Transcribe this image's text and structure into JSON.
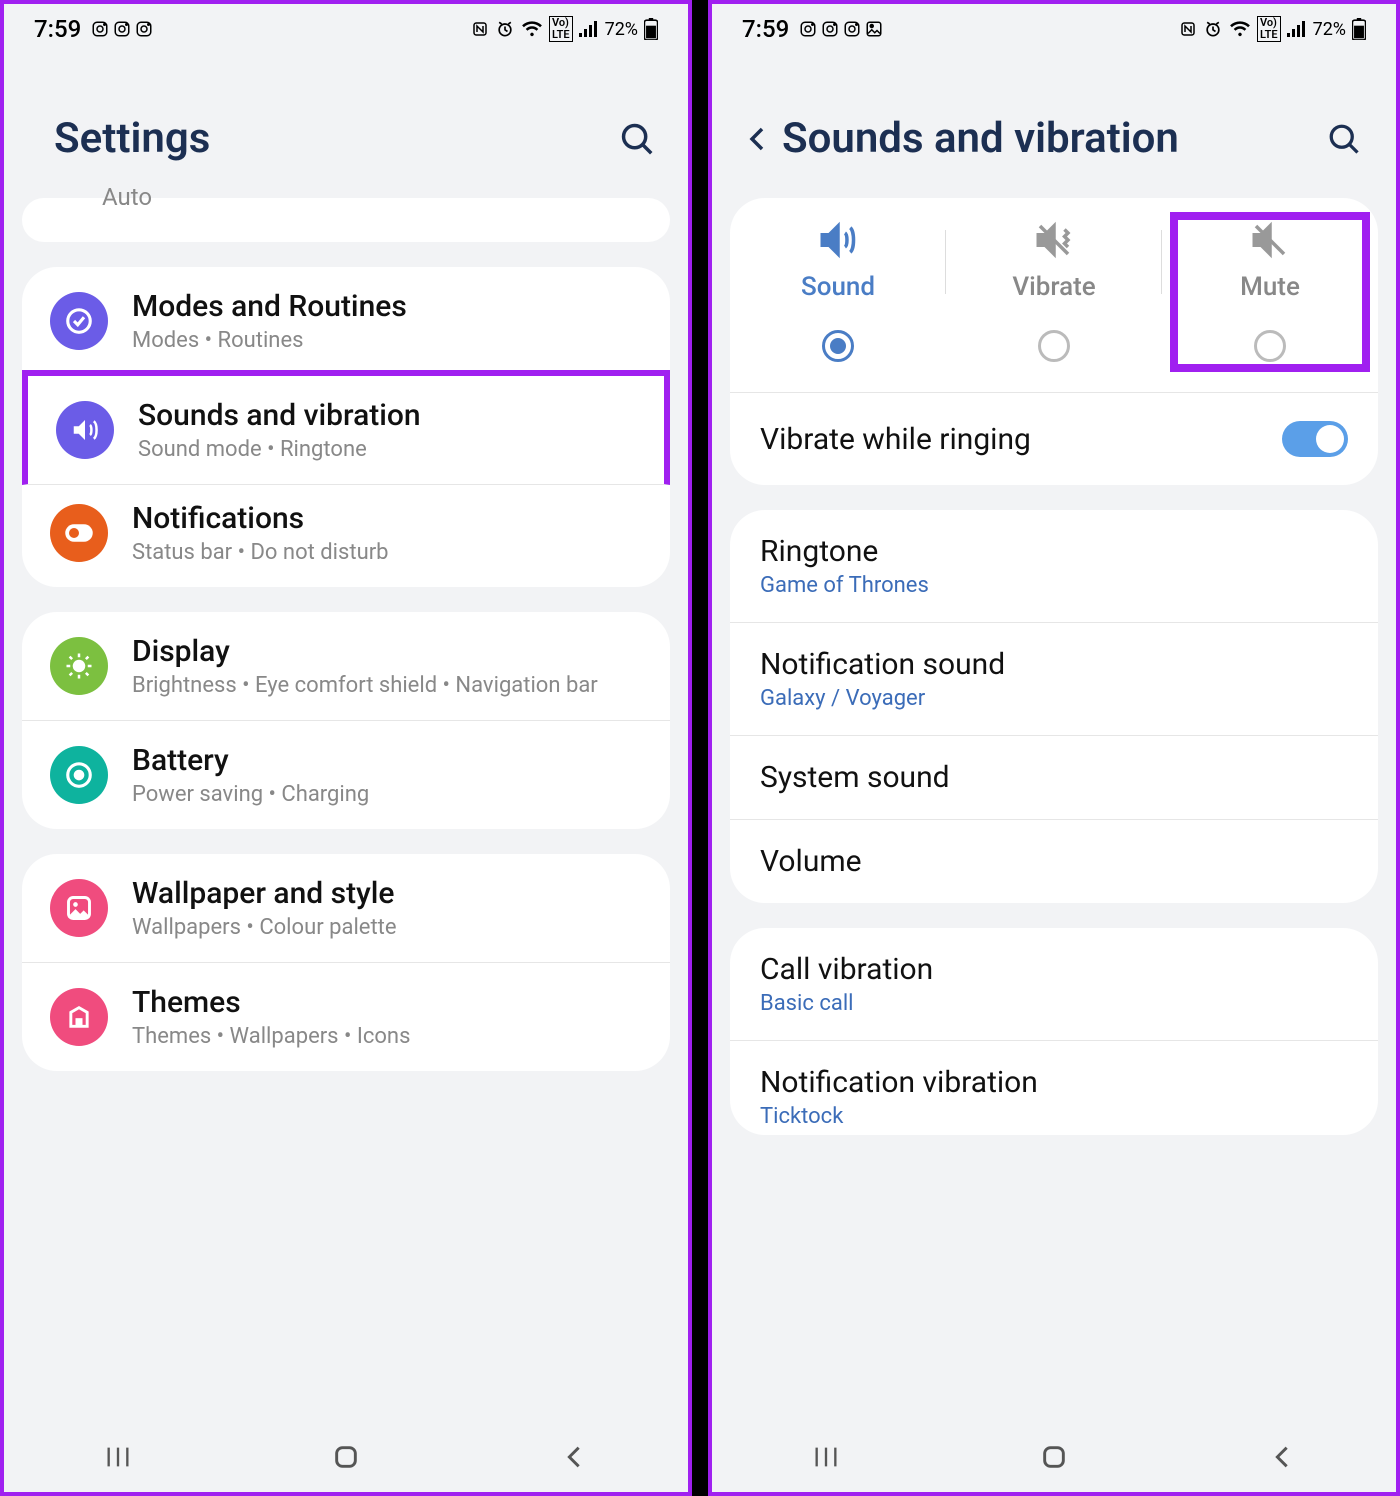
{
  "status": {
    "time": "7:59",
    "battery": "72%"
  },
  "left_screen": {
    "header_title": "Settings",
    "partial_top": "Auto",
    "groups": [
      {
        "items": [
          {
            "name": "modes",
            "title": "Modes and Routines",
            "subtitle": "Modes  •  Routines",
            "icon_color": "#6b5ce7"
          },
          {
            "name": "sounds",
            "title": "Sounds and vibration",
            "subtitle": "Sound mode  •  Ringtone",
            "icon_color": "#6b5ce7",
            "highlight": true
          },
          {
            "name": "notifications",
            "title": "Notifications",
            "subtitle": "Status bar  •  Do not disturb",
            "icon_color": "#e85e1c"
          }
        ]
      },
      {
        "items": [
          {
            "name": "display",
            "title": "Display",
            "subtitle": "Brightness  •  Eye comfort shield  •  Navigation bar",
            "icon_color": "#7cc040"
          },
          {
            "name": "battery",
            "title": "Battery",
            "subtitle": "Power saving  •  Charging",
            "icon_color": "#0eb39e"
          }
        ]
      },
      {
        "items": [
          {
            "name": "wallpaper",
            "title": "Wallpaper and style",
            "subtitle": "Wallpapers  •  Colour palette",
            "icon_color": "#f04c7e"
          },
          {
            "name": "themes",
            "title": "Themes",
            "subtitle": "Themes  •  Wallpapers  •  Icons",
            "icon_color": "#f04c7e"
          }
        ]
      }
    ]
  },
  "right_screen": {
    "header_title": "Sounds and vibration",
    "modes": [
      {
        "name": "sound",
        "label": "Sound",
        "selected": true
      },
      {
        "name": "vibrate",
        "label": "Vibrate",
        "selected": false
      },
      {
        "name": "mute",
        "label": "Mute",
        "selected": false,
        "highlight": true
      }
    ],
    "vibrate_while_ringing": {
      "label": "Vibrate while ringing",
      "on": true
    },
    "sound_items": [
      {
        "title": "Ringtone",
        "value": "Game of Thrones"
      },
      {
        "title": "Notification sound",
        "value": "Galaxy / Voyager"
      },
      {
        "title": "System sound"
      },
      {
        "title": "Volume"
      }
    ],
    "vibration_items": [
      {
        "title": "Call vibration",
        "value": "Basic call"
      },
      {
        "title": "Notification vibration",
        "value": "Ticktock"
      }
    ]
  }
}
